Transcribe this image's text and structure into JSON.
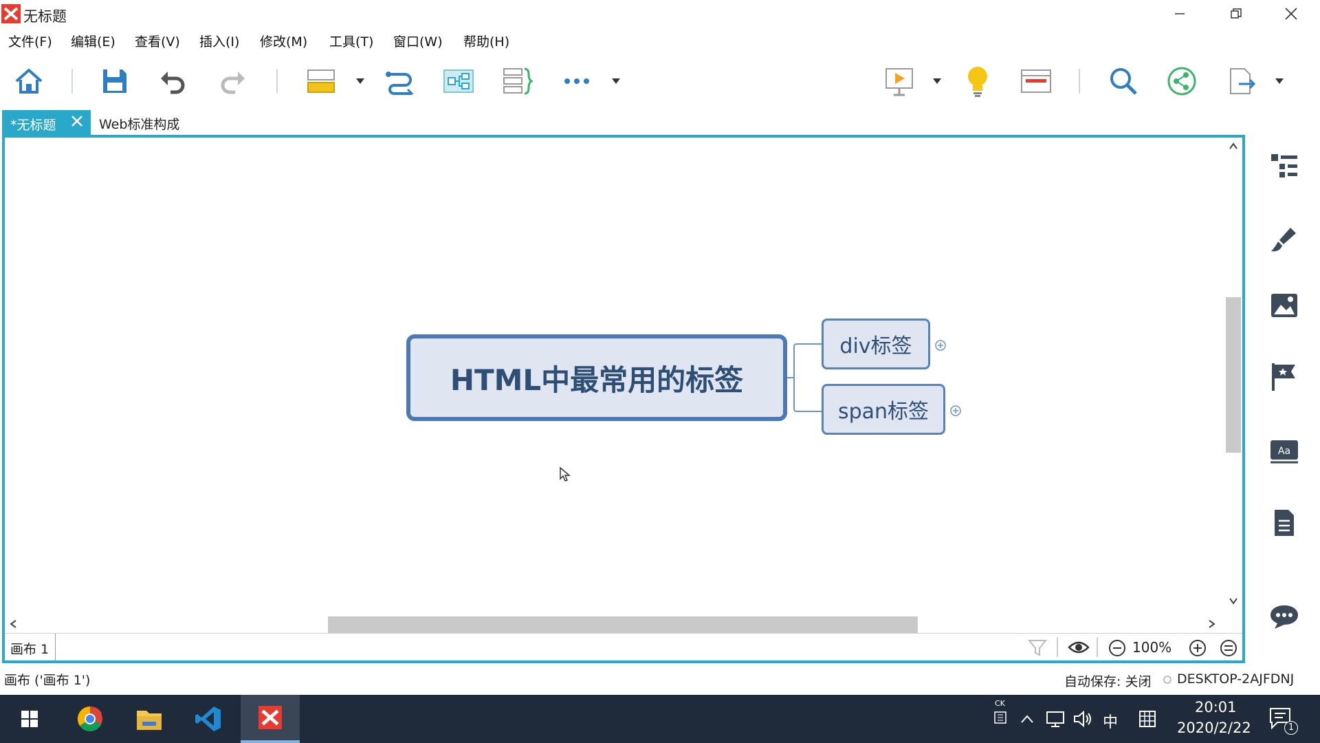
{
  "window": {
    "title": "无标题"
  },
  "menu": [
    "文件(F)",
    "编辑(E)",
    "查看(V)",
    "插入(I)",
    "修改(M)",
    "工具(T)",
    "窗口(W)",
    "帮助(H)"
  ],
  "tabs": {
    "active": "*无标题",
    "second": "Web标准构成"
  },
  "mindmap": {
    "central": "HTML中最常用的标签",
    "subtopics": [
      "div标签",
      "span标签"
    ]
  },
  "sheet": {
    "tab": "画布 1",
    "zoom": "100%"
  },
  "status": {
    "left": "画布 ('画布 1')",
    "autosave": "自动保存: 关闭",
    "machine": "DESKTOP-2AJFDNJ"
  },
  "taskbar": {
    "tray_ime_top": "CK",
    "ime": "中",
    "time": "20:01",
    "date": "2020/2/22",
    "notifications": "1"
  },
  "colors": {
    "accent": "#2aa8c9",
    "node_border": "#4a79b6",
    "node_fill": "#dfe6f2",
    "node_text": "#2f4e74"
  }
}
